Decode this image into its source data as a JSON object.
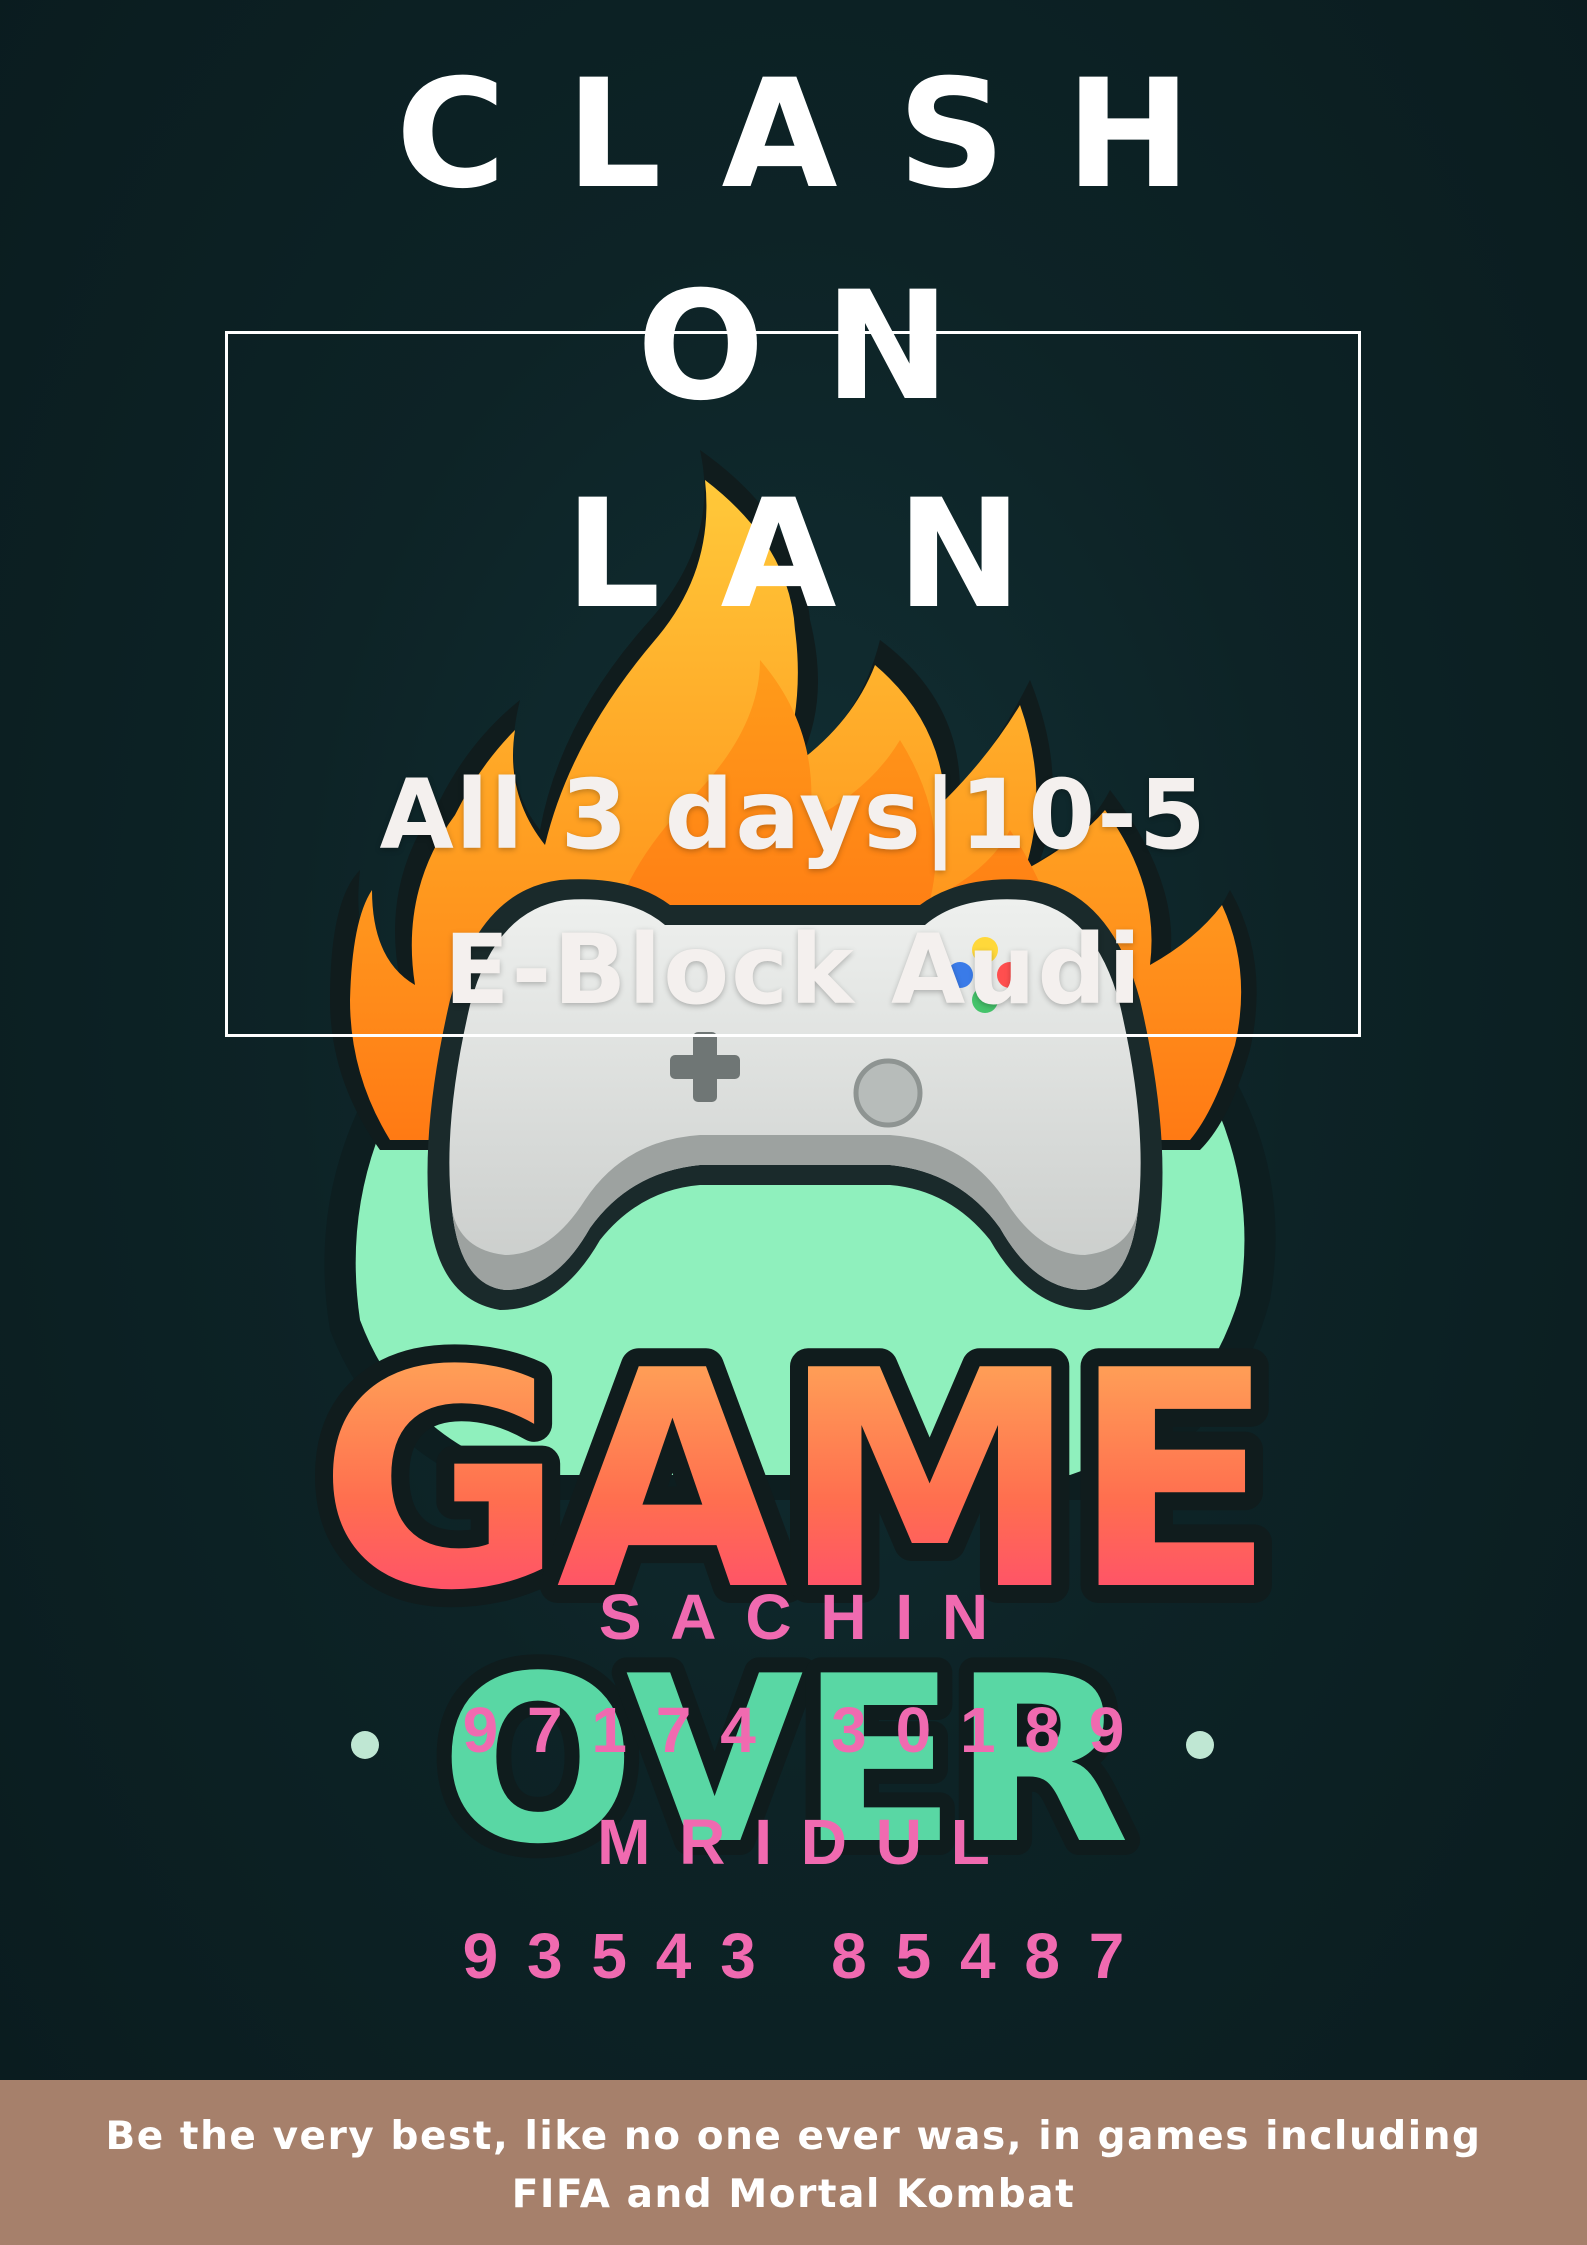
{
  "poster": {
    "title_lines": [
      "CLASH",
      "ON",
      "LAN"
    ],
    "event_details": {
      "schedule": "All 3 days|10-5",
      "venue": "E-Block Audi"
    },
    "artwork": {
      "icon": "flaming-game-controller-icon",
      "logo_words": [
        "GAME",
        "OVER"
      ]
    },
    "contacts": [
      {
        "name": "SACHIN",
        "phone": "97174 30189"
      },
      {
        "name": "MRIDUL",
        "phone": "93543 85487"
      }
    ],
    "footer": {
      "line1": "Be the very best, like no one ever was, in games including",
      "line2": "FIFA and Mortal Kombat"
    },
    "colors": {
      "background": "#0d2326",
      "contact_text": "#f06ab0",
      "footer_band": "#a6806b"
    }
  }
}
